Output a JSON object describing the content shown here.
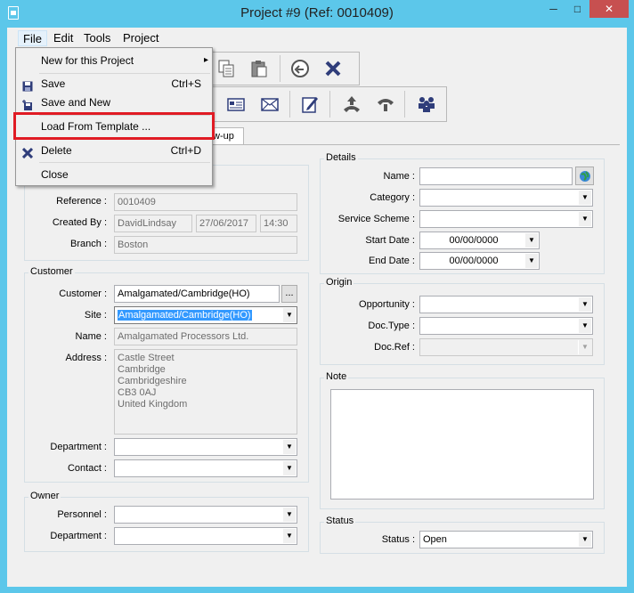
{
  "window": {
    "title": "Project #9 (Ref: 0010409)",
    "min": "─",
    "max": "□",
    "close": "✕"
  },
  "menubar": {
    "items": [
      "File",
      "Edit",
      "Tools",
      "Project"
    ]
  },
  "file_menu": {
    "new_label": "New for this Project",
    "new_arrow": "▸",
    "save_label": "Save",
    "save_shortcut": "Ctrl+S",
    "save_new_label": "Save and New",
    "load_template_label": "Load From Template ...",
    "delete_label": "Delete",
    "delete_shortcut": "Ctrl+D",
    "close_label": "Close"
  },
  "tabs": {
    "partial_tab": "w-up"
  },
  "project": {
    "reference_label": "Reference :",
    "reference": "0010409",
    "created_by_label": "Created By :",
    "created_by": "DavidLindsay",
    "created_date": "27/06/2017",
    "created_time": "14:30",
    "branch_label": "Branch :",
    "branch": "Boston"
  },
  "customer": {
    "group_title": "Customer",
    "customer_label": "Customer :",
    "customer_value": "Amalgamated/Cambridge(HO)",
    "browse": "...",
    "site_label": "Site :",
    "site_value": "Amalgamated/Cambridge(HO)",
    "name_label": "Name :",
    "name_value": "Amalgamated Processors Ltd.",
    "address_label": "Address :",
    "address_lines": [
      "Castle Street",
      "Cambridge",
      "Cambridgeshire",
      "CB3 0AJ",
      "United Kingdom"
    ],
    "department_label": "Department :",
    "department_value": "",
    "contact_label": "Contact :",
    "contact_value": ""
  },
  "owner": {
    "group_title": "Owner",
    "personnel_label": "Personnel :",
    "personnel_value": "",
    "department_label": "Department :",
    "department_value": ""
  },
  "details": {
    "group_title": "Details",
    "name_label": "Name :",
    "name_value": "",
    "category_label": "Category :",
    "category_value": "",
    "service_scheme_label": "Service Scheme :",
    "service_scheme_value": "",
    "start_date_label": "Start Date :",
    "start_date_value": "00/00/0000",
    "end_date_label": "End Date :",
    "end_date_value": "00/00/0000"
  },
  "origin": {
    "group_title": "Origin",
    "opportunity_label": "Opportunity :",
    "opportunity_value": "",
    "doc_type_label": "Doc.Type :",
    "doc_type_value": "",
    "doc_ref_label": "Doc.Ref :",
    "doc_ref_value": ""
  },
  "note": {
    "group_title": "Note",
    "value": ""
  },
  "status": {
    "group_title": "Status",
    "status_label": "Status :",
    "status_value": "Open"
  },
  "colors": {
    "title_bar": "#5cc7ea",
    "highlight": "#e01b24",
    "selection": "#3399ff"
  }
}
